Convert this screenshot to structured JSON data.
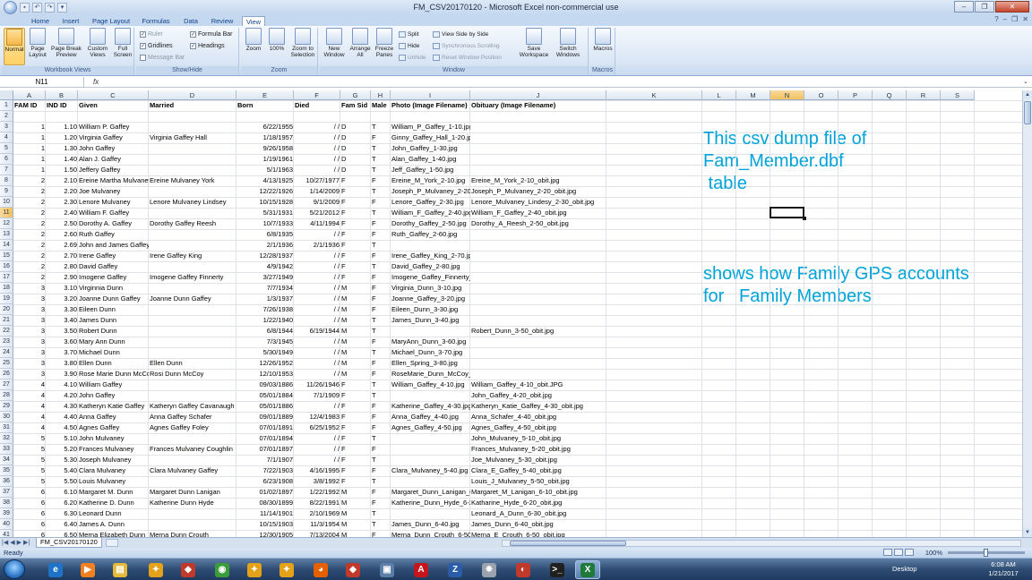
{
  "window": {
    "title": "FM_CSV20170120 - Microsoft Excel non-commercial use"
  },
  "ribbon": {
    "tabs": [
      "Home",
      "Insert",
      "Page Layout",
      "Formulas",
      "Data",
      "Review",
      "View"
    ],
    "active_tab": "View",
    "groups": {
      "workbook_views": {
        "label": "Workbook Views",
        "buttons": [
          {
            "label": "Normal",
            "icon": "normal-view-icon"
          },
          {
            "label": "Page Layout",
            "icon": "page-layout-icon"
          },
          {
            "label": "Page Break Preview",
            "icon": "page-break-icon"
          },
          {
            "label": "Custom Views",
            "icon": "custom-views-icon"
          },
          {
            "label": "Full Screen",
            "icon": "full-screen-icon"
          }
        ]
      },
      "show_hide": {
        "label": "Show/Hide",
        "ruler": "Ruler",
        "gridlines": "Gridlines",
        "message_bar": "Message Bar",
        "formula_bar": "Formula Bar",
        "headings": "Headings"
      },
      "zoom": {
        "label": "Zoom",
        "zoom": "Zoom",
        "hundred": "100%",
        "zoom_to_selection": "Zoom to Selection"
      },
      "window": {
        "label": "Window",
        "new_window": "New Window",
        "arrange_all": "Arrange All",
        "freeze_panes": "Freeze Panes",
        "split": "Split",
        "hide": "Hide",
        "unhide": "Unhide",
        "side_by_side": "View Side by Side",
        "sync_scroll": "Synchronous Scrolling",
        "reset_pos": "Reset Window Position",
        "save_workspace": "Save Workspace",
        "switch_windows": "Switch Windows"
      },
      "macros": {
        "label": "Macros",
        "button": "Macros"
      }
    }
  },
  "formula_bar": {
    "name_box": "N11",
    "fx": "fx",
    "value": ""
  },
  "sheet": {
    "columns": [
      "A",
      "B",
      "C",
      "D",
      "E",
      "F",
      "G",
      "H",
      "I",
      "J",
      "K",
      "L",
      "M",
      "N",
      "O",
      "P",
      "Q",
      "R",
      "S"
    ],
    "selected_column": "N",
    "selected_row": "11",
    "headers": [
      "FAM ID",
      "IND ID",
      "Given",
      "Married",
      "Born",
      "Died",
      "Fam Sid",
      "Male",
      "Photo (Image Filename)",
      "Obituary (Image Filename)"
    ],
    "rows": [
      {
        "n": "3",
        "c": [
          "1",
          "1.10",
          "William P. Gaffey",
          "",
          "6/22/1955",
          "/ /",
          "D",
          "T",
          "William_P_Gaffey_1-10.jpg",
          ""
        ]
      },
      {
        "n": "4",
        "c": [
          "1",
          "1.20",
          "Virginia Gaffey",
          "Virginia Gaffey Hall",
          "1/18/1957",
          "/ /",
          "D",
          "F",
          "Ginny_Gaffey_Hall_1-20.jpg",
          ""
        ]
      },
      {
        "n": "5",
        "c": [
          "1",
          "1.30",
          "John Gaffey",
          "",
          "9/26/1958",
          "/ /",
          "D",
          "T",
          "John_Gaffey_1-30.jpg",
          ""
        ]
      },
      {
        "n": "6",
        "c": [
          "1",
          "1.40",
          "Alan J. Gaffey",
          "",
          "1/19/1961",
          "/ /",
          "D",
          "T",
          "Alan_Gaffey_1-40.jpg",
          ""
        ]
      },
      {
        "n": "7",
        "c": [
          "1",
          "1.50",
          "Jeffery Gaffey",
          "",
          "5/1/1963",
          "/ /",
          "D",
          "T",
          "Jeff_Gaffey_1-50.jpg",
          ""
        ]
      },
      {
        "n": "8",
        "c": [
          "2",
          "2.10",
          "Ereine Martha Mulvaney",
          "Ereine Mulvaney York",
          "4/13/1925",
          "10/27/1977",
          "F",
          "F",
          "Ereine_M_York_2-10.jpg",
          "Ereine_M_York_2-10_obit.jpg"
        ]
      },
      {
        "n": "9",
        "c": [
          "2",
          "2.20",
          "Joe Mulvaney",
          "",
          "12/22/1926",
          "1/14/2009",
          "F",
          "T",
          "Joseph_P_Mulvaney_2-20.jpg",
          "Joseph_P_Mulvaney_2-20_obit.jpg"
        ]
      },
      {
        "n": "10",
        "c": [
          "2",
          "2.30",
          "Lenore Mulvaney",
          "Lenore Mulvaney Lindsey",
          "10/15/1928",
          "9/1/2009",
          "F",
          "F",
          "Lenore_Gaffey_2-30.jpg",
          "Lenore_Mulvaney_Lindesy_2-30_obit.jpg"
        ]
      },
      {
        "n": "11",
        "c": [
          "2",
          "2.40",
          "William F. Gaffey",
          "",
          "5/31/1931",
          "5/21/2012",
          "F",
          "T",
          "William_F_Gaffey_2-40.jpg",
          "William_F_Gaffey_2-40_obit.jpg"
        ]
      },
      {
        "n": "12",
        "c": [
          "2",
          "2.50",
          "Dorothy A. Gaffey",
          "Dorothy Gaffey Reesh",
          "10/7/1933",
          "4/11/1994",
          "F",
          "F",
          "Dorothy_Gaffey_2-50.jpg",
          "Dorothy_A_Reesh_2-50_obit.jpg"
        ]
      },
      {
        "n": "13",
        "c": [
          "2",
          "2.60",
          "Ruth Gaffey",
          "",
          "6/8/1935",
          "/ /",
          "F",
          "F",
          "Ruth_Gaffey_2-60.jpg",
          ""
        ]
      },
      {
        "n": "14",
        "c": [
          "2",
          "2.69",
          "John and James Gaffey",
          "",
          "2/1/1936",
          "2/1/1936",
          "F",
          "T",
          "",
          ""
        ]
      },
      {
        "n": "15",
        "c": [
          "2",
          "2.70",
          "Irene Gaffey",
          "Irene Gaffey King",
          "12/28/1937",
          "/ /",
          "F",
          "F",
          "Irene_Gaffey_King_2-70.jpg",
          ""
        ]
      },
      {
        "n": "16",
        "c": [
          "2",
          "2.80",
          "David Gaffey",
          "",
          "4/9/1942",
          "/ /",
          "F",
          "T",
          "David_Gaffey_2-80.jpg",
          ""
        ]
      },
      {
        "n": "17",
        "c": [
          "2",
          "2.90",
          "Imogene Gaffey",
          "Imogene Gaffey Finnerty",
          "3/27/1949",
          "/ /",
          "F",
          "F",
          "Imogene_Gaffey_Finnerty_2-90.jpg",
          ""
        ]
      },
      {
        "n": "18",
        "c": [
          "3",
          "3.10",
          "Virginnia Dunn",
          "",
          "7/7/1934",
          "/ /",
          "M",
          "F",
          "Virginia_Dunn_3-10.jpg",
          ""
        ]
      },
      {
        "n": "19",
        "c": [
          "3",
          "3.20",
          "Joanne Dunn Gaffey",
          "Joanne Dunn Gaffey",
          "1/3/1937",
          "/ /",
          "M",
          "F",
          "Joanne_Gaffey_3-20.jpg",
          ""
        ]
      },
      {
        "n": "20",
        "c": [
          "3",
          "3.30",
          "Eileen Dunn",
          "",
          "7/26/1938",
          "/ /",
          "M",
          "F",
          "Eileen_Dunn_3-30.jpg",
          ""
        ]
      },
      {
        "n": "21",
        "c": [
          "3",
          "3.40",
          "James Dunn",
          "",
          "1/22/1940",
          "/ /",
          "M",
          "T",
          "James_Dunn_3-40.jpg",
          ""
        ]
      },
      {
        "n": "22",
        "c": [
          "3",
          "3.50",
          "Robert Dunn",
          "",
          "6/8/1944",
          "6/19/1944",
          "M",
          "T",
          "",
          "Robert_Dunn_3-50_obit.jpg"
        ]
      },
      {
        "n": "23",
        "c": [
          "3",
          "3.60",
          "Mary Ann Dunn",
          "",
          "7/3/1945",
          "/ /",
          "M",
          "F",
          "MaryAnn_Dunn_3-60.jpg",
          ""
        ]
      },
      {
        "n": "24",
        "c": [
          "3",
          "3.70",
          "Michael Dunn",
          "",
          "5/30/1949",
          "/ /",
          "M",
          "T",
          "Michael_Dunn_3-70.jpg",
          ""
        ]
      },
      {
        "n": "25",
        "c": [
          "3",
          "3.80",
          "Ellen Dunn",
          "Ellen Dunn",
          "12/26/1952",
          "/ /",
          "M",
          "F",
          "Ellen_Spring_3-80.jpg",
          ""
        ]
      },
      {
        "n": "26",
        "c": [
          "3",
          "3.90",
          "Rose Marie Dunn McCoy",
          "Rosi Dunn McCoy",
          "12/10/1953",
          "/ /",
          "M",
          "F",
          "RoseMarie_Dunn_McCoy_3-90.jpg",
          ""
        ]
      },
      {
        "n": "27",
        "c": [
          "4",
          "4.10",
          "William Gaffey",
          "",
          "09/03/1886",
          "11/26/1946",
          "F",
          "T",
          "William_Gaffey_4-10.jpg",
          "William_Gaffey_4-10_obit.JPG"
        ]
      },
      {
        "n": "28",
        "c": [
          "4",
          "4.20",
          "John Gaffey",
          "",
          "05/01/1884",
          "7/1/1909",
          "F",
          "T",
          "",
          "John_Gaffey_4-20_obit.jpg"
        ]
      },
      {
        "n": "29",
        "c": [
          "4",
          "4.30",
          "Katheryn Katie Gaffey",
          "Katheryn Gaffey Cavanaugh",
          "05/01/1886",
          "/ /",
          "F",
          "F",
          "Katherine_Gaffey_4-30.jpg",
          "Katheryn_Katie_Gaffey_4-30_obit.jpg"
        ]
      },
      {
        "n": "30",
        "c": [
          "4",
          "4.40",
          "Anna Gaffey",
          "Anna Gaffey Schafer",
          "09/01/1889",
          "12/4/1983",
          "F",
          "F",
          "Anna_Gaffey_4-40.jpg",
          "Anna_Schafer_4-40_obit.jpg"
        ]
      },
      {
        "n": "31",
        "c": [
          "4",
          "4.50",
          "Agnes Gaffey",
          "Agnes Gaffey Foley",
          "07/01/1891",
          "6/25/1952",
          "F",
          "F",
          "Agnes_Gaffey_4-50.jpg",
          "Agnes_Gaffey_4-50_obit.jpg"
        ]
      },
      {
        "n": "32",
        "c": [
          "5",
          "5.10",
          "John Mulvaney",
          "",
          "07/01/1894",
          "/ /",
          "F",
          "T",
          "",
          "John_Mulvaney_5-10_obit.jpg"
        ]
      },
      {
        "n": "33",
        "c": [
          "5",
          "5.20",
          "Frances Mulvaney",
          "Frances Mulvaney Coughlin",
          "07/01/1897",
          "/ /",
          "F",
          "F",
          "",
          "Frances_Mulvaney_5-20_obit.jpg"
        ]
      },
      {
        "n": "34",
        "c": [
          "5",
          "5.30",
          "Joseph Mulvaney",
          "",
          "7/1/1907",
          "/ /",
          "F",
          "T",
          "",
          "Joe_Mulvaney_5-30_obit.jpg"
        ]
      },
      {
        "n": "35",
        "c": [
          "5",
          "5.40",
          "Clara Mulvaney",
          "Clara Mulvaney Gaffey",
          "7/22/1903",
          "4/16/1995",
          "F",
          "F",
          "Clara_Mulvaney_5-40.jpg",
          "Clara_E_Gaffey_5-40_obit.jpg"
        ]
      },
      {
        "n": "36",
        "c": [
          "5",
          "5.50",
          "Louis Mulvaney",
          "",
          "6/23/1908",
          "3/8/1992",
          "F",
          "T",
          "",
          "Louis_J_Mulvaney_5-50_obit.jpg"
        ]
      },
      {
        "n": "37",
        "c": [
          "6",
          "6.10",
          "Margaret M. Dunn",
          "Margaret Dunn Lanigan",
          "01/02/1897",
          "1/22/1992",
          "M",
          "F",
          "Margaret_Dunn_Lanigan_6-10.jpg",
          "Margaret_M_Lanigan_6-10_obit.jpg"
        ]
      },
      {
        "n": "38",
        "c": [
          "6",
          "6.20",
          "Katherine D. Dunn",
          "Katherine Dunn Hyde",
          "08/30/1899",
          "8/22/1991",
          "M",
          "F",
          "Katherine_Dunn_Hyde_6-20.jpg",
          "Katharine_Hyde_6-20_obit.jpg"
        ]
      },
      {
        "n": "39",
        "c": [
          "6",
          "6.30",
          "Leonard Dunn",
          "",
          "11/14/1901",
          "2/10/1969",
          "M",
          "T",
          "",
          "Leonard_A_Dunn_6-30_obit.jpg"
        ]
      },
      {
        "n": "40",
        "c": [
          "6",
          "6.40",
          "James A. Dunn",
          "",
          "10/15/1903",
          "11/3/1954",
          "M",
          "T",
          "James_Dunn_6-40.jpg",
          "James_Dunn_6-40_obit.jpg"
        ]
      },
      {
        "n": "41",
        "c": [
          "6",
          "6.50",
          "Merna Elizabeth Dunn",
          "Merna Dunn Crouth",
          "12/30/1905",
          "7/13/2004",
          "M",
          "F",
          "Merna_Dunn_Crouth_6-50.jpg",
          "Merna_E_Crouth_6-50_obit.jpg"
        ]
      }
    ],
    "notes": [
      "This csv dump file of\nFam_Member.dbf\n table",
      "shows how Family GPS accounts\nfor   Family Members"
    ],
    "sheet_tab": "FM_CSV20170120"
  },
  "status": {
    "ready": "Ready",
    "zoom": "100%"
  },
  "taskbar": {
    "apps": [
      {
        "name": "internet-explorer-icon",
        "glyph": "e",
        "color": "#1e73c8"
      },
      {
        "name": "media-player-icon",
        "glyph": "▶",
        "color": "#f08020"
      },
      {
        "name": "file-explorer-icon",
        "glyph": "▤",
        "color": "#e5b93a"
      },
      {
        "name": "app-icon-1",
        "glyph": "✦",
        "color": "#e3a21a"
      },
      {
        "name": "app-icon-2",
        "glyph": "◆",
        "color": "#c0392b"
      },
      {
        "name": "chrome-icon",
        "glyph": "◉",
        "color": "#3b9d3a"
      },
      {
        "name": "app-icon-3",
        "glyph": "✦",
        "color": "#e3a21a"
      },
      {
        "name": "app-icon-4",
        "glyph": "✦",
        "color": "#e3a21a"
      },
      {
        "name": "firefox-icon",
        "glyph": "◕",
        "color": "#e66000"
      },
      {
        "name": "app-icon-5",
        "glyph": "◆",
        "color": "#c0392b"
      },
      {
        "name": "window-icon",
        "glyph": "▣",
        "color": "#5b7ea8"
      },
      {
        "name": "acrobat-icon",
        "glyph": "A",
        "color": "#c4161c"
      },
      {
        "name": "zip-icon",
        "glyph": "Z",
        "color": "#2a5ca8"
      },
      {
        "name": "tools-icon",
        "glyph": "✸",
        "color": "#9aa3ad"
      },
      {
        "name": "paint-icon",
        "glyph": "◐",
        "color": "#c0392b"
      },
      {
        "name": "cmd-icon",
        "glyph": ">_",
        "color": "#202020"
      },
      {
        "name": "excel-icon",
        "glyph": "X",
        "color": "#1f7a3a"
      }
    ],
    "desktop": "Desktop",
    "time": "6:08 AM",
    "date": "1/21/2017"
  }
}
